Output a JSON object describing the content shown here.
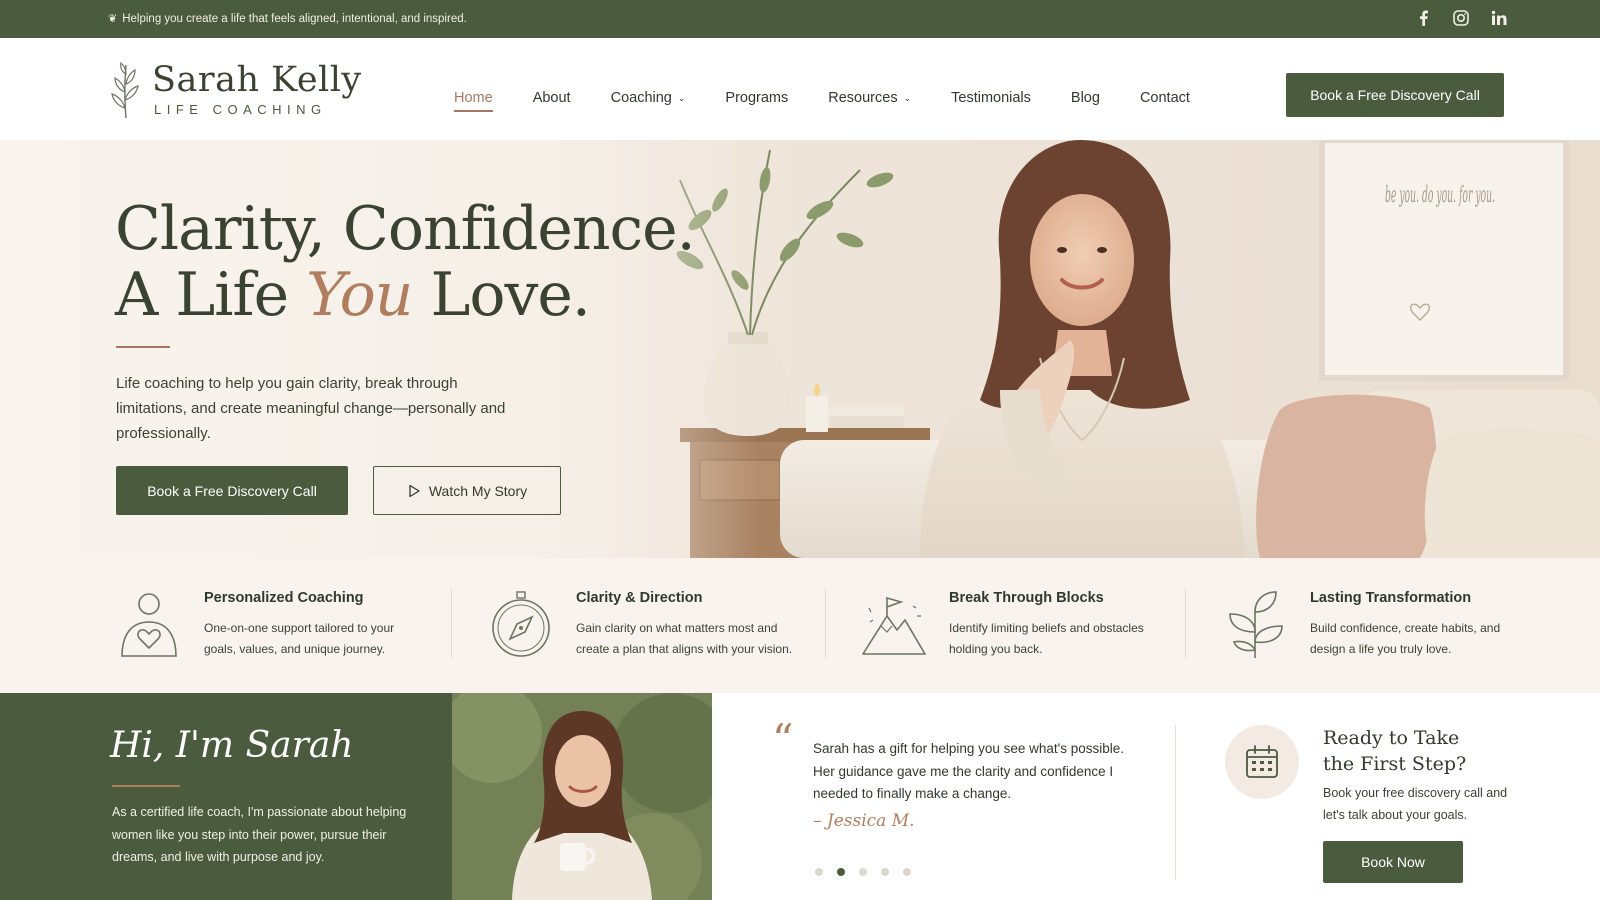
{
  "topbar": {
    "tagline": "Helping you create a life that feels aligned, intentional, and inspired.",
    "socials": [
      "facebook-icon",
      "instagram-icon",
      "linkedin-icon"
    ]
  },
  "brand": {
    "name": "Sarah Kelly",
    "subtitle": "LIFE COACHING",
    "logo_icon": "leaf-branch-icon"
  },
  "nav": {
    "items": [
      {
        "label": "Home",
        "active": true
      },
      {
        "label": "About"
      },
      {
        "label": "Coaching",
        "dropdown": true
      },
      {
        "label": "Programs"
      },
      {
        "label": "Resources",
        "dropdown": true
      },
      {
        "label": "Testimonials"
      },
      {
        "label": "Blog"
      },
      {
        "label": "Contact"
      }
    ],
    "cta_label": "Book a Free Discovery Call"
  },
  "hero": {
    "headline_line1": "Clarity, Confidence.",
    "headline_line2_prefix": "A Life ",
    "headline_line2_emphasis": "You",
    "headline_line2_suffix": " Love.",
    "description": "Life coaching to help you gain clarity, break through limitations, and create meaningful change—personally and professionally.",
    "primary_button": "Book a Free Discovery Call",
    "secondary_button": "Watch My Story",
    "wall_art_text": "be you. do you. for you."
  },
  "features": [
    {
      "title": "Personalized Coaching",
      "text": "One-on-one support tailored to your goals, values, and unique journey.",
      "icon": "person-heart-icon"
    },
    {
      "title": "Clarity & Direction",
      "text": "Gain clarity on what matters most and create a plan that aligns with your vision.",
      "icon": "compass-icon"
    },
    {
      "title": "Break Through Blocks",
      "text": "Identify limiting beliefs and obstacles holding you back.",
      "icon": "mountain-flag-icon"
    },
    {
      "title": "Lasting Transformation",
      "text": "Build confidence, create habits, and design a life you truly love.",
      "icon": "sprout-icon"
    }
  ],
  "about": {
    "greeting": "Hi, I'm Sarah",
    "text": "As a certified life coach, I'm passionate about helping women like you step into their power, pursue their dreams, and live with purpose and joy."
  },
  "testimonial": {
    "quote": "Sarah has a gift for helping you see what's possible. Her guidance gave me the clarity and confidence I needed to finally make a change.",
    "author": "– Jessica M.",
    "dots": 5,
    "active_dot": 2
  },
  "next_step": {
    "title": "Ready to Take the First Step?",
    "text": "Book your free discovery call and let's talk about your goals.",
    "button": "Book Now",
    "icon": "calendar-icon"
  },
  "colors": {
    "primary": "#4a5b3e",
    "accent": "#b07e5e",
    "cream": "#f8f3ee"
  }
}
